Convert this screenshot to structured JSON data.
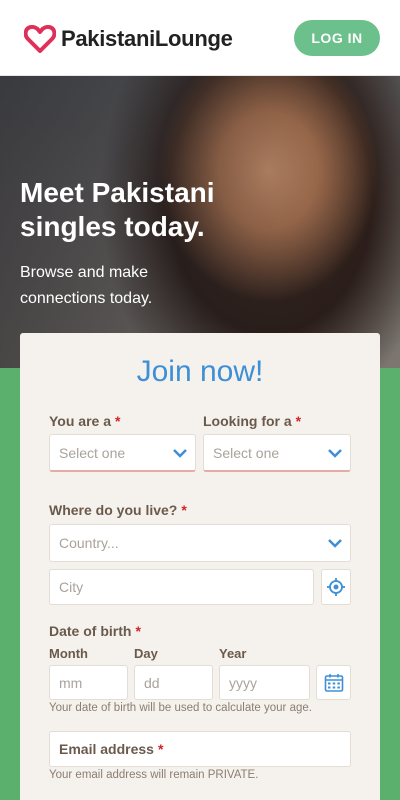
{
  "header": {
    "brand": "PakistaniLounge",
    "login_label": "LOG IN"
  },
  "hero": {
    "title": "Meet Pakistani singles today.",
    "subtitle": "Browse and make connections today."
  },
  "form": {
    "title": "Join now!",
    "you_are": {
      "label": "You are a",
      "placeholder": "Select one"
    },
    "looking_for": {
      "label": "Looking for a",
      "placeholder": "Select one"
    },
    "location": {
      "label": "Where do you live?",
      "country_placeholder": "Country...",
      "city_placeholder": "City"
    },
    "dob": {
      "label": "Date of birth",
      "month_label": "Month",
      "day_label": "Day",
      "year_label": "Year",
      "month_placeholder": "mm",
      "day_placeholder": "dd",
      "year_placeholder": "yyyy",
      "hint": "Your date of birth will be used to calculate your age."
    },
    "email": {
      "label": "Email address",
      "hint": "Your email address will remain PRIVATE."
    },
    "required_mark": "*"
  },
  "colors": {
    "brand_green": "#6cc08b",
    "accent_blue": "#3d8fd6",
    "required_red": "#d02525",
    "logo_pink": "#e0305a"
  },
  "icons": {
    "logo": "heart-logo-icon",
    "dropdown": "chevron-down-icon",
    "location": "crosshair-icon",
    "calendar": "calendar-icon"
  }
}
